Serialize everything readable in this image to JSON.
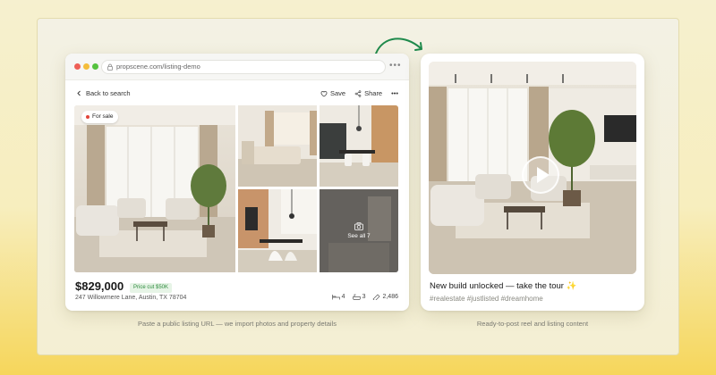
{
  "browser": {
    "url": "propscene.com/listing-demo",
    "more_icon": "more-horizontal-icon",
    "back_label": "Back to search",
    "save_label": "Save",
    "share_label": "Share"
  },
  "listing": {
    "status_badge": "For sale",
    "see_all_label": "See all 7",
    "price": "$829,000",
    "price_cut": "Price cut $50K",
    "address": "247 Willowmere Lane, Austin, TX 78704",
    "beds": "4",
    "baths": "3",
    "sqft": "2,486"
  },
  "reel": {
    "title": "New build unlocked — take the tour",
    "title_emoji": "✨",
    "hashtags": "#realestate #justlisted #dreamhome"
  },
  "captions": {
    "left": "Paste a public listing URL — we import photos and property details",
    "right": "Ready-to-post reel and listing content"
  },
  "colors": {
    "accent_green": "#2e8b3e",
    "arrow_green": "#1f8a4c",
    "status_red": "#e2453a"
  }
}
